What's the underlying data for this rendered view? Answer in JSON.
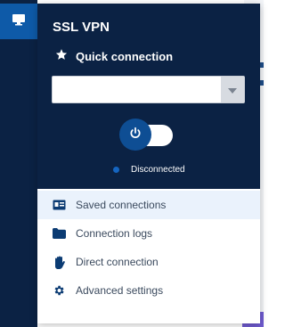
{
  "panel": {
    "title": "SSL VPN",
    "quick_connection_label": "Quick connection",
    "select_value": "",
    "status_text": "Disconnected"
  },
  "menu": [
    {
      "label": "Saved connections",
      "icon": "id-card-icon"
    },
    {
      "label": "Connection logs",
      "icon": "folder-icon"
    },
    {
      "label": "Direct connection",
      "icon": "hand-icon"
    },
    {
      "label": "Advanced settings",
      "icon": "gear-icon"
    }
  ],
  "colors": {
    "navy": "#0b2244",
    "accent": "#0e5aa8",
    "toggle_knob": "#0e4e94",
    "status_dot": "#1565c0",
    "menu_active_bg": "#eaf2fc"
  }
}
